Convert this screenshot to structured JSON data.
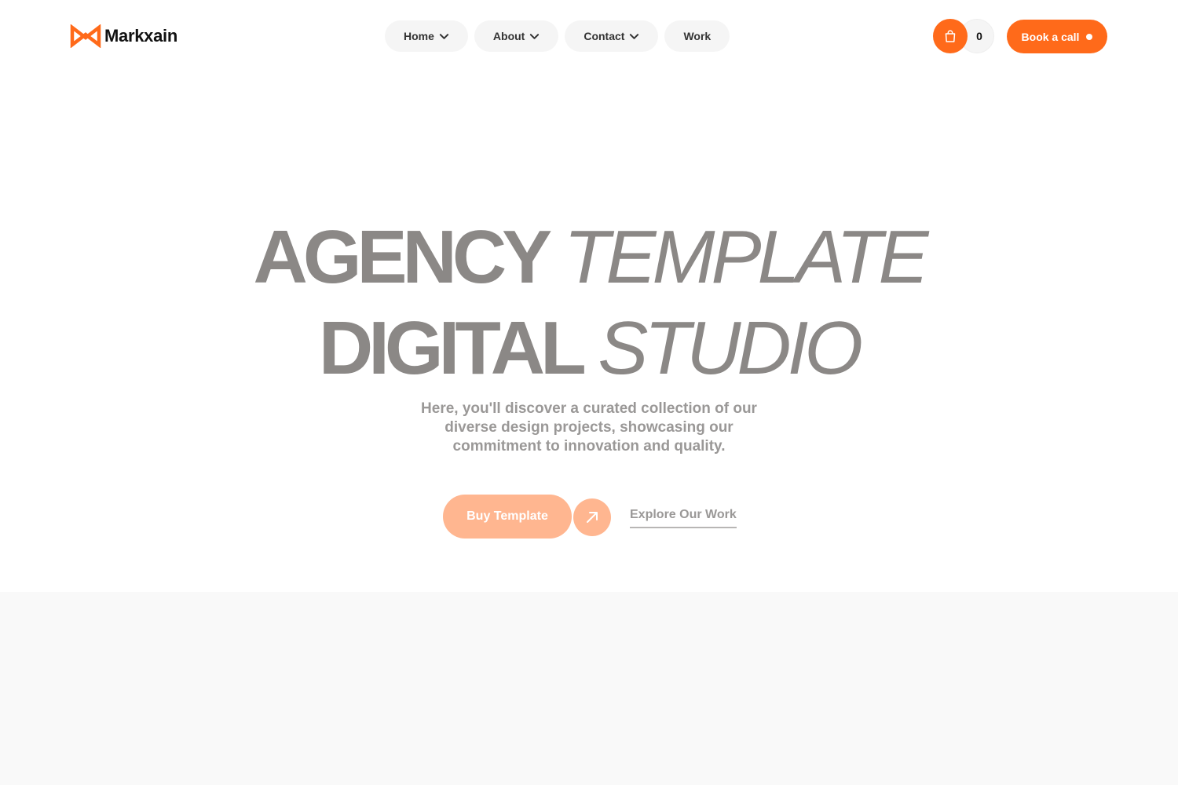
{
  "brand": {
    "name": "Markxain",
    "accent_color": "#ff6a1a",
    "logo_icon": "bowtie-m-logo"
  },
  "nav": {
    "items": [
      {
        "label": "Home",
        "has_dropdown": true
      },
      {
        "label": "About",
        "has_dropdown": true
      },
      {
        "label": "Contact",
        "has_dropdown": true
      },
      {
        "label": "Work",
        "has_dropdown": false
      }
    ]
  },
  "cart": {
    "icon": "shopping-bag-icon",
    "count": "0"
  },
  "header_cta": {
    "label": "Book a call"
  },
  "hero": {
    "line1_strong": "AGENCY",
    "line1_light": "TEMPLATE",
    "line2_strong": "DIGITAL",
    "line2_light": "STUDIO",
    "subtitle": "Here, you'll discover a curated collection of our diverse design projects, showcasing our commitment to innovation and quality.",
    "primary_button": "Buy Template",
    "primary_button_color": "#ffb690",
    "arrow_icon": "arrow-up-right-icon",
    "secondary_link": "Explore Our Work"
  }
}
